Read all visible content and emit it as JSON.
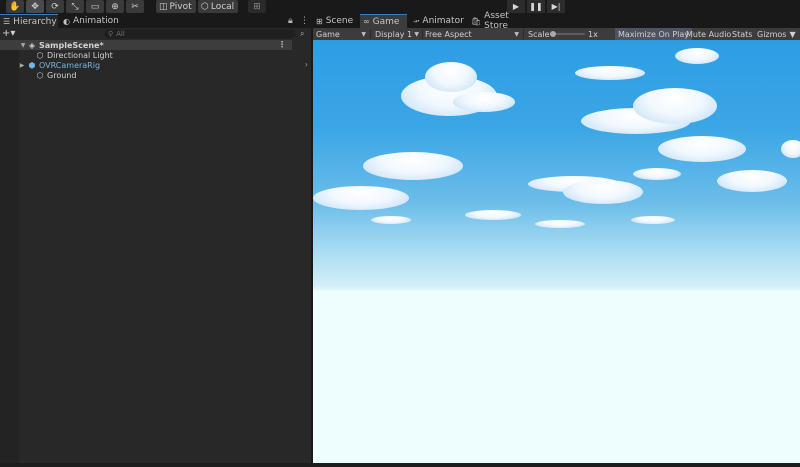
{
  "toolbar": {
    "tools": [
      "hand-tool",
      "move-tool",
      "rotate-tool",
      "scale-tool",
      "rect-tool",
      "transform-tool",
      "custom-tool"
    ],
    "pivot_label": "Pivot",
    "local_label": "Local"
  },
  "play_controls": [
    "play",
    "pause",
    "step"
  ],
  "left_panel": {
    "tabs": [
      {
        "label": "Hierarchy"
      },
      {
        "label": "Animation"
      }
    ],
    "search_placeholder": "All",
    "tree": [
      {
        "label": "SampleScene*",
        "level": 0,
        "expanded": true
      },
      {
        "label": "Directional Light",
        "level": 1
      },
      {
        "label": "OVRCameraRig",
        "level": 1,
        "prefab": true
      },
      {
        "label": "Ground",
        "level": 1
      }
    ]
  },
  "right_panel": {
    "tabs": [
      {
        "label": "Scene"
      },
      {
        "label": "Game"
      },
      {
        "label": "Animator"
      },
      {
        "label": "Asset Store"
      }
    ],
    "game_bar": {
      "mode": "Game",
      "display": "Display 1",
      "aspect": "Free Aspect",
      "scale_label": "Scale",
      "scale_value": "1x",
      "maximize_label": "Maximize On Play",
      "mute_label": "Mute Audio",
      "stats_label": "Stats",
      "gizmos_label": "Gizmos"
    }
  },
  "colors": {
    "accent": "#3a79bb",
    "prefab": "#73b6e6",
    "sky_top": "#2e9de3",
    "ground": "#eefdfe"
  }
}
